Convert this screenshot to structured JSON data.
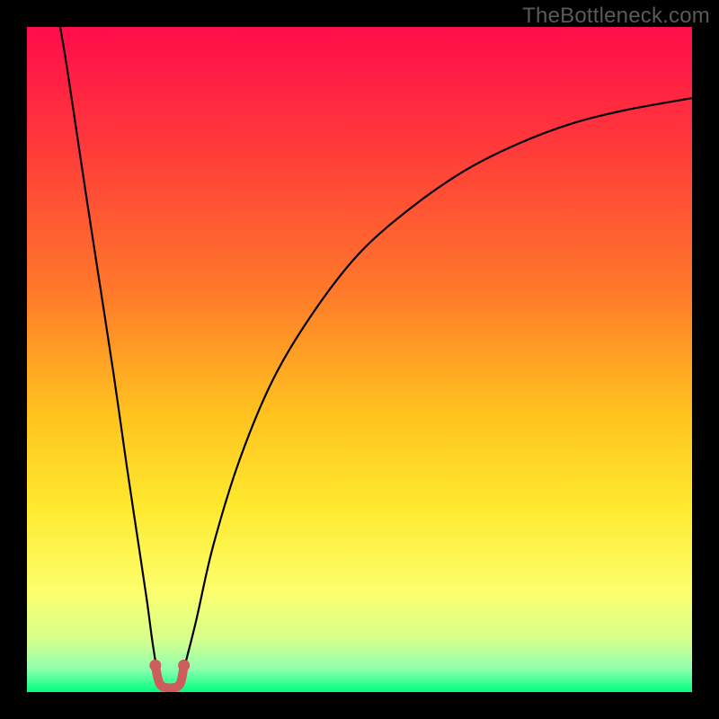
{
  "watermark": "TheBottleneck.com",
  "chart_data": {
    "type": "line",
    "title": "",
    "xlabel": "",
    "ylabel": "",
    "xlim": [
      0,
      100
    ],
    "ylim": [
      0,
      100
    ],
    "gradient_stops": [
      {
        "offset": 0,
        "color": "#ff0d4b"
      },
      {
        "offset": 0.18,
        "color": "#ff3a3a"
      },
      {
        "offset": 0.4,
        "color": "#ff7a2a"
      },
      {
        "offset": 0.58,
        "color": "#ffc21f"
      },
      {
        "offset": 0.72,
        "color": "#ffe92e"
      },
      {
        "offset": 0.85,
        "color": "#fcff6e"
      },
      {
        "offset": 0.92,
        "color": "#d7ff8c"
      },
      {
        "offset": 0.965,
        "color": "#8fffad"
      },
      {
        "offset": 1.0,
        "color": "#00ff7f"
      }
    ],
    "series": [
      {
        "name": "left-branch",
        "x": [
          5.0,
          6.0,
          7.5,
          9.0,
          11.0,
          13.0,
          15.0,
          16.5,
          18.0,
          18.8,
          19.5,
          20.0
        ],
        "y": [
          100.0,
          94.0,
          84.0,
          74.0,
          61.0,
          48.0,
          34.0,
          24.0,
          14.0,
          8.0,
          3.5,
          0.5
        ]
      },
      {
        "name": "right-branch",
        "x": [
          23.0,
          24.0,
          25.5,
          28.0,
          32.0,
          37.0,
          43.0,
          50.0,
          58.0,
          66.0,
          74.0,
          82.0,
          90.0,
          100.0
        ],
        "y": [
          1.0,
          5.0,
          11.0,
          22.0,
          35.0,
          47.0,
          57.0,
          66.0,
          73.0,
          78.5,
          82.5,
          85.5,
          87.5,
          89.3
        ]
      }
    ],
    "marker": {
      "name": "bottleneck-marker",
      "path_x": [
        19.3,
        20.0,
        21.5,
        23.0,
        23.6
      ],
      "path_y": [
        4.0,
        1.2,
        0.6,
        1.2,
        4.0
      ],
      "endpoints": [
        {
          "x": 19.3,
          "y": 4.0
        },
        {
          "x": 23.6,
          "y": 4.0
        }
      ]
    }
  }
}
